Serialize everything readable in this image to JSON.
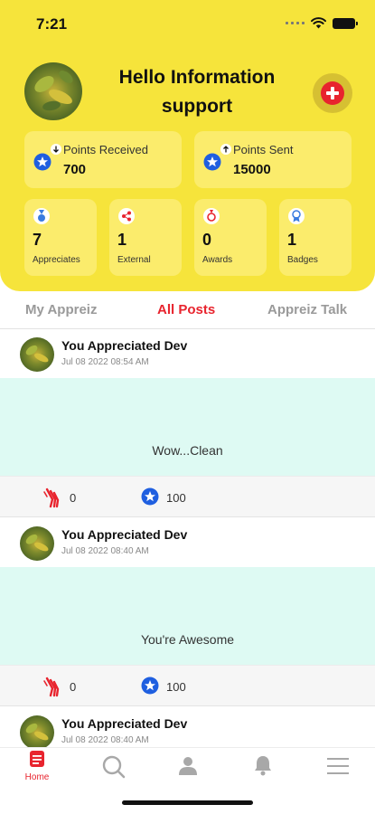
{
  "status_bar": {
    "time": "7:21"
  },
  "colors": {
    "header_yellow": "#f6e43b",
    "card_yellow": "#fbec6c",
    "accent_red": "#e8242e",
    "star_blue": "#1f5fe0",
    "post_bg": "#defaf3"
  },
  "header": {
    "greeting_line1": "Hello Information",
    "greeting_line2": "support",
    "add_icon": "plus-circle-icon"
  },
  "points": {
    "received_label": "Points Received",
    "received_value": "700",
    "sent_label": "Points Sent",
    "sent_value": "15000"
  },
  "stats": [
    {
      "value": "7",
      "label": "Appreciates",
      "icon": "medal-icon"
    },
    {
      "value": "1",
      "label": "External",
      "icon": "share-icon"
    },
    {
      "value": "0",
      "label": "Awards",
      "icon": "award-icon"
    },
    {
      "value": "1",
      "label": "Badges",
      "icon": "badge-icon"
    }
  ],
  "tabs": [
    {
      "label": "My Appreiz",
      "active": false
    },
    {
      "label": "All Posts",
      "active": true
    },
    {
      "label": "Appreiz Talk",
      "active": false
    }
  ],
  "posts": [
    {
      "author": "You Appreciated Dev",
      "date": "Jul 08 2022 08:54 AM",
      "message": "Wow...Clean",
      "claps": "0",
      "points": "100"
    },
    {
      "author": "You Appreciated Dev",
      "date": "Jul 08 2022 08:40 AM",
      "message": "You're Awesome",
      "claps": "0",
      "points": "100"
    },
    {
      "author": "You Appreciated Dev",
      "date": "Jul 08 2022 08:40 AM"
    }
  ],
  "bottom_nav": [
    {
      "label": "Home",
      "icon": "home-icon",
      "active": true
    },
    {
      "label": "",
      "icon": "search-icon",
      "active": false
    },
    {
      "label": "",
      "icon": "profile-icon",
      "active": false
    },
    {
      "label": "",
      "icon": "bell-icon",
      "active": false
    },
    {
      "label": "",
      "icon": "menu-icon",
      "active": false
    }
  ]
}
